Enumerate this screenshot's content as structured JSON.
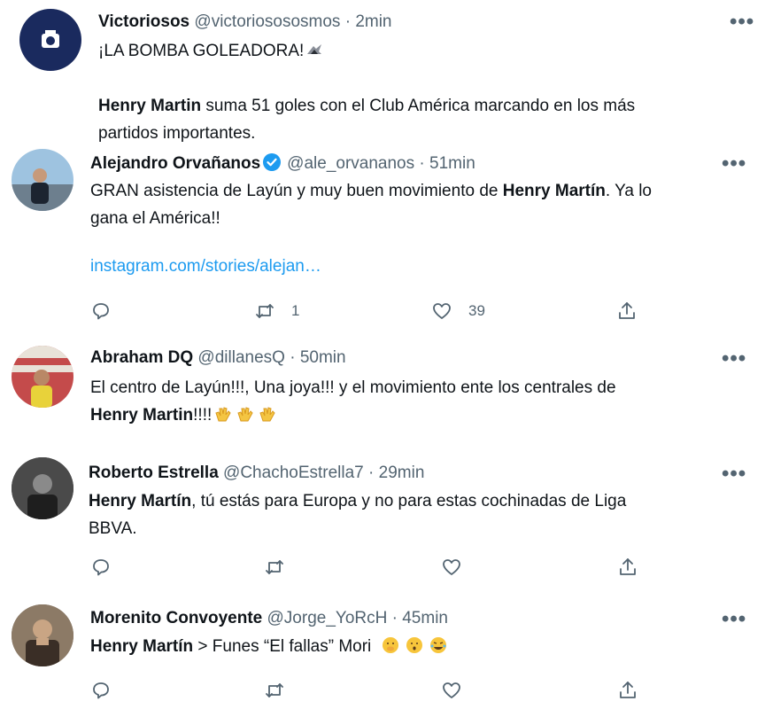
{
  "tweets": [
    {
      "name": "Victoriosos",
      "handle": "@victoriosososmos",
      "time": "2min",
      "line1": "¡LA BOMBA GOLEADORA!",
      "line2_bold": "Henry Martin",
      "line2_rest": " suma 51 goles con el Club América marcando en los más",
      "line3": "partidos importantes."
    },
    {
      "name": "Alejandro Orvañanos",
      "handle": "@ale_orvananos",
      "time": "51min",
      "line1_a": "GRAN asistencia de Layún y muy buen movimiento de ",
      "line1_bold": "Henry Martín",
      "line1_b": ". Ya lo",
      "line2": "gana el América!!",
      "link": "instagram.com/stories/alejan…",
      "retweets": "1",
      "likes": "39"
    },
    {
      "name": "Abraham DQ",
      "handle": "@dillanesQ",
      "time": "50min",
      "line1": "El centro de Layún!!!, Una joya!!! y el movimiento ente los centrales de",
      "line2_bold": "Henry Martin",
      "line2_rest": "!!!!"
    },
    {
      "name": "Roberto Estrella",
      "handle": "@ChachoEstrella7",
      "time": "29min",
      "line1_bold": "Henry Martín",
      "line1_rest": ", tú estás para Europa y no para estas cochinadas de Liga",
      "line2": "BBVA."
    },
    {
      "name": "Morenito Convoyente",
      "handle": "@Jorge_YoRcH",
      "time": "45min",
      "line1_bold": "Henry Martín",
      "line1_rest": " > Funes “El fallas” Mori"
    }
  ],
  "separator": "·",
  "more_label": "•••",
  "icons": [
    "reply-icon",
    "retweet-icon",
    "like-icon",
    "share-icon",
    "verified-icon"
  ],
  "colors": {
    "link": "#1d9bf0",
    "verified": "#1d9bf0",
    "muted": "#536471"
  }
}
